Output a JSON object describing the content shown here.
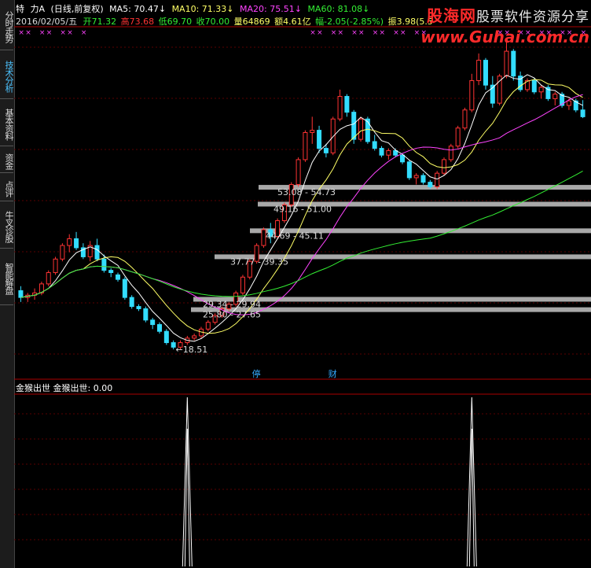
{
  "sidebar": {
    "tabs": [
      {
        "label": "分时走势",
        "active": false
      },
      {
        "label": "技术分析",
        "active": true
      },
      {
        "label": "基本资料",
        "active": false
      },
      {
        "label": "资金",
        "active": false
      },
      {
        "label": "点评",
        "active": false
      },
      {
        "label": "牛叉诊股",
        "active": false
      },
      {
        "label": "智能解盘",
        "active": false
      }
    ]
  },
  "header": {
    "special_mark": "特",
    "stock_name": "力A",
    "period": "(日线,前复权)",
    "ma5": "MA5: 70.47↓",
    "ma10": "MA10: 71.33↓",
    "ma20": "MA20: 75.51↓",
    "ma60": "MA60: 81.08↓",
    "date": "2016/02/05/五",
    "open": "开71.32",
    "high": "高73.68",
    "low": "低69.70",
    "close": "收70.00",
    "volume": "量64869",
    "amount": "额4.61亿",
    "change": "幅-2.05(-2.85%)",
    "amplitude": "振3.98(5.5"
  },
  "watermark": {
    "brand": "股海网",
    "tagline": "股票软件资源分享",
    "url": "www.Guhai.com.cn"
  },
  "colors": {
    "ma5": "#ffffff",
    "ma10": "#ffff66",
    "ma20": "#ff44ff",
    "ma60": "#33ee33",
    "up": "#ff3333",
    "down": "#33ddff",
    "zone": "#a8a8a8",
    "marker": "#ff44ff"
  },
  "indicator": {
    "label": "金猴出世 金猴出世: 0.00"
  },
  "chart_data": {
    "type": "candlestick",
    "x_markers": [
      "停",
      "财"
    ],
    "price_ylim": [
      14,
      88
    ],
    "candles": [
      {
        "o": 31.5,
        "h": 32.5,
        "l": 29.0,
        "c": 30.0
      },
      {
        "o": 30.0,
        "h": 31.0,
        "l": 29.0,
        "c": 30.5
      },
      {
        "o": 30.5,
        "h": 32.0,
        "l": 29.5,
        "c": 31.0
      },
      {
        "o": 31.0,
        "h": 33.5,
        "l": 30.5,
        "c": 33.0
      },
      {
        "o": 33.0,
        "h": 36.0,
        "l": 32.5,
        "c": 35.5
      },
      {
        "o": 35.5,
        "h": 39.0,
        "l": 35.0,
        "c": 38.5
      },
      {
        "o": 38.5,
        "h": 42.0,
        "l": 38.0,
        "c": 41.5
      },
      {
        "o": 41.5,
        "h": 44.0,
        "l": 40.0,
        "c": 43.0
      },
      {
        "o": 43.0,
        "h": 44.5,
        "l": 40.5,
        "c": 41.0
      },
      {
        "o": 41.0,
        "h": 42.0,
        "l": 38.5,
        "c": 39.0
      },
      {
        "o": 39.0,
        "h": 42.5,
        "l": 38.0,
        "c": 41.5
      },
      {
        "o": 41.5,
        "h": 43.0,
        "l": 38.0,
        "c": 38.5
      },
      {
        "o": 38.5,
        "h": 39.5,
        "l": 35.5,
        "c": 36.0
      },
      {
        "o": 36.0,
        "h": 36.5,
        "l": 34.5,
        "c": 35.5
      },
      {
        "o": 35.0,
        "h": 35.5,
        "l": 33.5,
        "c": 34.0
      },
      {
        "o": 34.0,
        "h": 34.5,
        "l": 29.5,
        "c": 30.0
      },
      {
        "o": 30.0,
        "h": 30.5,
        "l": 27.5,
        "c": 28.0
      },
      {
        "o": 28.0,
        "h": 28.5,
        "l": 27.0,
        "c": 27.5
      },
      {
        "o": 27.5,
        "h": 28.0,
        "l": 24.5,
        "c": 25.0
      },
      {
        "o": 25.0,
        "h": 25.5,
        "l": 23.0,
        "c": 24.0
      },
      {
        "o": 24.0,
        "h": 24.5,
        "l": 22.0,
        "c": 22.5
      },
      {
        "o": 22.5,
        "h": 23.0,
        "l": 19.5,
        "c": 20.0
      },
      {
        "o": 20.0,
        "h": 20.5,
        "l": 18.5,
        "c": 19.0
      },
      {
        "o": 19.0,
        "h": 20.5,
        "l": 18.51,
        "c": 20.0
      },
      {
        "o": 20.0,
        "h": 21.5,
        "l": 19.5,
        "c": 21.0
      },
      {
        "o": 21.0,
        "h": 22.0,
        "l": 20.5,
        "c": 21.5
      },
      {
        "o": 21.5,
        "h": 23.5,
        "l": 21.0,
        "c": 23.0
      },
      {
        "o": 23.0,
        "h": 25.0,
        "l": 22.5,
        "c": 24.5
      },
      {
        "o": 24.5,
        "h": 26.5,
        "l": 24.0,
        "c": 26.0
      },
      {
        "o": 26.0,
        "h": 28.0,
        "l": 25.5,
        "c": 27.5
      },
      {
        "o": 27.5,
        "h": 29.0,
        "l": 27.0,
        "c": 28.5
      },
      {
        "o": 28.5,
        "h": 31.5,
        "l": 28.0,
        "c": 31.0
      },
      {
        "o": 31.0,
        "h": 35.0,
        "l": 30.5,
        "c": 34.5
      },
      {
        "o": 34.5,
        "h": 38.5,
        "l": 34.0,
        "c": 38.0
      },
      {
        "o": 38.0,
        "h": 42.0,
        "l": 37.5,
        "c": 41.5
      },
      {
        "o": 41.5,
        "h": 45.5,
        "l": 41.0,
        "c": 45.0
      },
      {
        "o": 45.0,
        "h": 46.5,
        "l": 42.0,
        "c": 43.5
      },
      {
        "o": 43.5,
        "h": 47.5,
        "l": 43.0,
        "c": 47.0
      },
      {
        "o": 47.0,
        "h": 51.0,
        "l": 46.5,
        "c": 50.5
      },
      {
        "o": 50.5,
        "h": 55.5,
        "l": 50.0,
        "c": 55.0
      },
      {
        "o": 55.0,
        "h": 61.0,
        "l": 54.5,
        "c": 60.5
      },
      {
        "o": 60.5,
        "h": 67.0,
        "l": 60.0,
        "c": 66.5
      },
      {
        "o": 66.5,
        "h": 70.0,
        "l": 64.0,
        "c": 67.0
      },
      {
        "o": 67.0,
        "h": 68.0,
        "l": 62.0,
        "c": 63.0
      },
      {
        "o": 63.0,
        "h": 64.0,
        "l": 61.0,
        "c": 62.0
      },
      {
        "o": 62.0,
        "h": 70.0,
        "l": 61.5,
        "c": 69.5
      },
      {
        "o": 69.5,
        "h": 76.0,
        "l": 69.0,
        "c": 74.5
      },
      {
        "o": 74.5,
        "h": 75.0,
        "l": 70.0,
        "c": 71.0
      },
      {
        "o": 71.0,
        "h": 71.5,
        "l": 64.0,
        "c": 65.0
      },
      {
        "o": 65.0,
        "h": 70.0,
        "l": 64.5,
        "c": 69.5
      },
      {
        "o": 69.5,
        "h": 70.0,
        "l": 64.0,
        "c": 64.5
      },
      {
        "o": 64.5,
        "h": 66.0,
        "l": 62.5,
        "c": 63.0
      },
      {
        "o": 63.0,
        "h": 63.5,
        "l": 61.0,
        "c": 61.5
      },
      {
        "o": 61.5,
        "h": 63.0,
        "l": 60.5,
        "c": 62.5
      },
      {
        "o": 62.5,
        "h": 63.0,
        "l": 61.0,
        "c": 61.5
      },
      {
        "o": 61.5,
        "h": 62.0,
        "l": 59.5,
        "c": 60.0
      },
      {
        "o": 60.0,
        "h": 60.5,
        "l": 56.0,
        "c": 56.5
      },
      {
        "o": 56.5,
        "h": 57.5,
        "l": 55.0,
        "c": 57.0
      },
      {
        "o": 57.0,
        "h": 57.5,
        "l": 55.0,
        "c": 55.5
      },
      {
        "o": 55.5,
        "h": 56.0,
        "l": 54.0,
        "c": 54.5
      },
      {
        "o": 54.5,
        "h": 58.0,
        "l": 54.0,
        "c": 57.5
      },
      {
        "o": 57.5,
        "h": 61.0,
        "l": 57.0,
        "c": 60.5
      },
      {
        "o": 60.5,
        "h": 64.0,
        "l": 60.0,
        "c": 63.5
      },
      {
        "o": 63.5,
        "h": 68.0,
        "l": 63.0,
        "c": 67.5
      },
      {
        "o": 67.5,
        "h": 72.0,
        "l": 67.0,
        "c": 71.5
      },
      {
        "o": 71.5,
        "h": 79.5,
        "l": 71.0,
        "c": 78.0
      },
      {
        "o": 78.0,
        "h": 84.0,
        "l": 77.0,
        "c": 82.5
      },
      {
        "o": 82.5,
        "h": 83.0,
        "l": 76.0,
        "c": 77.0
      },
      {
        "o": 77.0,
        "h": 79.0,
        "l": 72.0,
        "c": 73.0
      },
      {
        "o": 73.0,
        "h": 79.5,
        "l": 72.5,
        "c": 79.0
      },
      {
        "o": 79.0,
        "h": 86.5,
        "l": 78.5,
        "c": 84.5
      },
      {
        "o": 84.5,
        "h": 85.0,
        "l": 78.0,
        "c": 79.0
      },
      {
        "o": 79.0,
        "h": 80.0,
        "l": 75.5,
        "c": 76.0
      },
      {
        "o": 76.0,
        "h": 78.5,
        "l": 75.5,
        "c": 78.0
      },
      {
        "o": 78.0,
        "h": 78.5,
        "l": 75.0,
        "c": 75.5
      },
      {
        "o": 75.5,
        "h": 77.0,
        "l": 74.0,
        "c": 76.5
      },
      {
        "o": 76.5,
        "h": 77.0,
        "l": 73.5,
        "c": 74.0
      },
      {
        "o": 74.0,
        "h": 75.5,
        "l": 72.5,
        "c": 75.0
      },
      {
        "o": 75.0,
        "h": 75.5,
        "l": 72.0,
        "c": 72.5
      },
      {
        "o": 72.5,
        "h": 74.0,
        "l": 71.5,
        "c": 73.5
      },
      {
        "o": 73.5,
        "h": 74.0,
        "l": 71.0,
        "c": 71.5
      },
      {
        "o": 71.5,
        "h": 73.68,
        "l": 69.7,
        "c": 70.0
      }
    ],
    "price_zones": [
      {
        "label": "18.51",
        "price": 18.51,
        "type": "low_marker"
      },
      {
        "label": "25.80 - 27.65",
        "from": 25.8,
        "to": 27.65
      },
      {
        "label": "29.34 - 29.94",
        "from": 29.34,
        "to": 29.94
      },
      {
        "label": "37.77 - 39.35",
        "from": 37.77,
        "to": 39.35
      },
      {
        "label": "44.69 - 45.11",
        "from": 44.69,
        "to": 45.11
      },
      {
        "label": "49.16 - 51.00",
        "from": 49.16,
        "to": 51.0
      },
      {
        "label": "53.08 - 54.73",
        "from": 53.08,
        "to": 54.73
      }
    ],
    "indicator": {
      "name": "金猴出世",
      "value": 0.0,
      "spike_candles": [
        24,
        65
      ]
    }
  }
}
